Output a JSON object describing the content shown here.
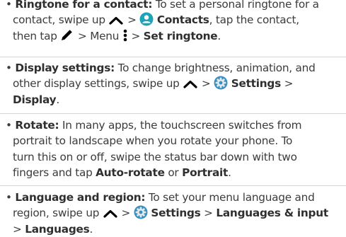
{
  "bullet": "•",
  "sep": ">",
  "items": [
    {
      "title": "Ringtone for a contact:",
      "l1": "To set a personal ringtone for a",
      "l2a": "contact, swipe up",
      "contacts": "Contacts",
      "l2b": ", tap the contact,",
      "l3a": "then tap",
      "menu": "Menu",
      "set_ringtone": "Set ringtone"
    },
    {
      "title": "Display settings:",
      "l1": "To change brightness, animation, and",
      "l2a": "other display settings, swipe up",
      "settings": "Settings",
      "display": "Display"
    },
    {
      "title": "Rotate:",
      "l1": "In many apps, the touchscreen switches from",
      "l2": "portrait to landscape when you rotate your phone. To",
      "l3": "turn this on or off, swipe the status bar down with two",
      "l4a": "fingers and tap",
      "auto_rotate": "Auto-rotate",
      "or": "or",
      "portrait": "Portrait"
    },
    {
      "title": "Language and region:",
      "l1": "To set your menu language and",
      "l2a": "region, swipe up",
      "settings": "Settings",
      "languages_input": "Languages & input",
      "languages": "Languages"
    }
  ],
  "colors": {
    "text": "#3c3c3c",
    "divider": "#d4d4d4",
    "contacts_icon": "#1fa3b6",
    "settings_icon": "#3b8fbf"
  }
}
